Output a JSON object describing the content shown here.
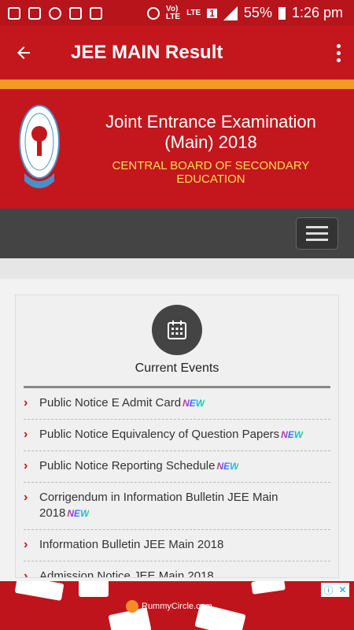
{
  "status_bar": {
    "left_icons": [
      "chat-icon",
      "image-icon",
      "wifi-calling-icon",
      "gmail-icon",
      "clipboard-icon"
    ],
    "volte": "Vo)\nLTE",
    "lte": "LTE",
    "sim": "1",
    "battery_percent": "55%",
    "time": "1:26 pm"
  },
  "appbar": {
    "title": "JEE MAIN Result"
  },
  "banner": {
    "title_line1": "Joint Entrance Examination",
    "title_line2": "(Main) 2018",
    "subtitle_line1": "CENTRAL BOARD OF SECONDARY",
    "subtitle_line2": "EDUCATION"
  },
  "card": {
    "heading": "Current Events",
    "new_label": "NEW",
    "items": [
      {
        "text": "Public Notice E Admit Card",
        "new": true
      },
      {
        "text": "Public Notice Equivalency of Question Papers",
        "new": true
      },
      {
        "text": "Public Notice Reporting Schedule",
        "new": true
      },
      {
        "text": "Corrigendum in Information Bulletin JEE Main 2018",
        "new": true
      },
      {
        "text": "Information Bulletin JEE Main 2018",
        "new": false
      },
      {
        "text": "Admission Notice JEE Main 2018",
        "new": false
      }
    ]
  },
  "ad": {
    "brand": "RummyCircle.com"
  },
  "colors": {
    "primary_red": "#c4161d",
    "status_red": "#b7141b",
    "accent_orange": "#f59a23",
    "subtitle_yellow": "#f8e04f",
    "nav_gray": "#444444"
  }
}
